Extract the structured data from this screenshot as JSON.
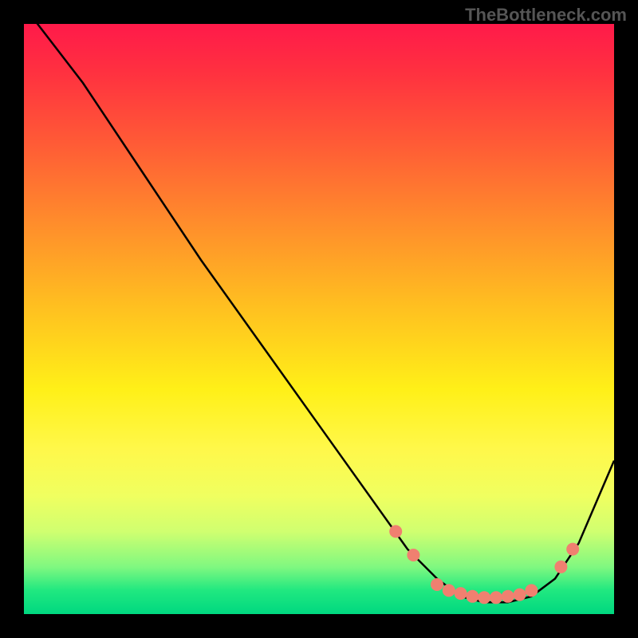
{
  "watermark": "TheBottleneck.com",
  "chart_data": {
    "type": "line",
    "title": "",
    "xlabel": "",
    "ylabel": "",
    "xlim": [
      0,
      100
    ],
    "ylim": [
      0,
      100
    ],
    "series": [
      {
        "name": "curve",
        "x": [
          0,
          10,
          20,
          30,
          40,
          50,
          60,
          65,
          70,
          74,
          78,
          82,
          86,
          90,
          94,
          100
        ],
        "y": [
          103,
          90,
          75,
          60,
          46,
          32,
          18,
          11,
          6,
          3,
          2,
          2,
          3,
          6,
          12,
          26
        ]
      }
    ],
    "markers": {
      "name": "red-dots",
      "x": [
        63,
        66,
        70,
        72,
        74,
        76,
        78,
        80,
        82,
        84,
        86,
        91,
        93
      ],
      "y": [
        14,
        10,
        5,
        4,
        3.5,
        3,
        2.8,
        2.8,
        3,
        3.3,
        4,
        8,
        11
      ]
    },
    "gradient_stops": [
      {
        "pct": 0,
        "color": "#ff1a4a"
      },
      {
        "pct": 20,
        "color": "#ff5a36"
      },
      {
        "pct": 48,
        "color": "#ffc020"
      },
      {
        "pct": 72,
        "color": "#fff84a"
      },
      {
        "pct": 92,
        "color": "#80f880"
      },
      {
        "pct": 100,
        "color": "#00d880"
      }
    ]
  }
}
